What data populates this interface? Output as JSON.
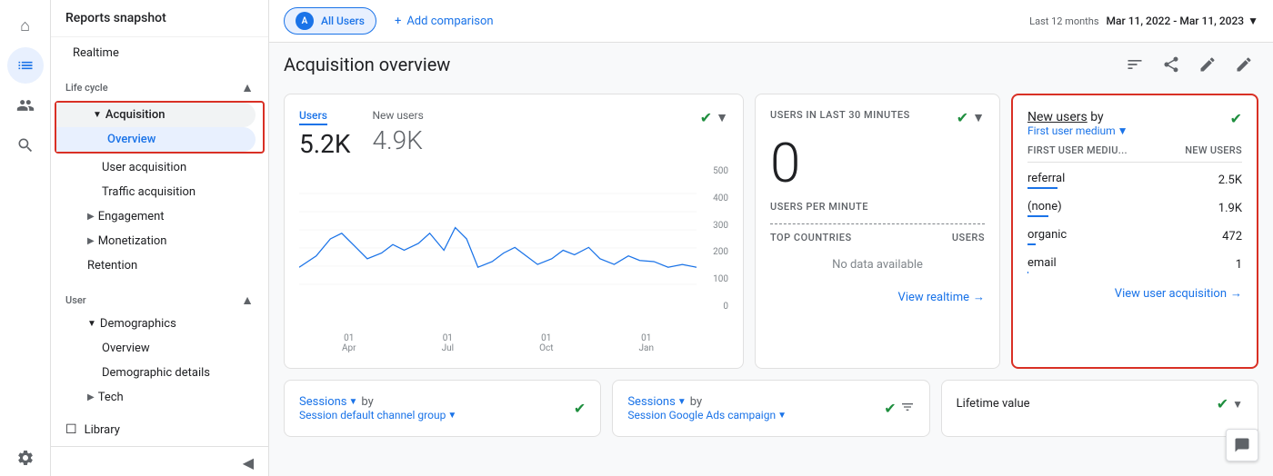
{
  "app": {
    "title": "Reports snapshot"
  },
  "sidebar_left": {
    "icons": [
      {
        "name": "home-icon",
        "symbol": "⌂",
        "active": false
      },
      {
        "name": "analytics-icon",
        "symbol": "📊",
        "active": true
      },
      {
        "name": "people-icon",
        "symbol": "👥",
        "active": false
      },
      {
        "name": "search-icon",
        "symbol": "🔍",
        "active": false
      },
      {
        "name": "settings-icon",
        "symbol": "⚙",
        "active": false
      }
    ]
  },
  "sidebar": {
    "reports_label": "Reports snapshot",
    "realtime_label": "Realtime",
    "lifecycle_label": "Life cycle",
    "acquisition_label": "Acquisition",
    "overview_label": "Overview",
    "user_acquisition_label": "User acquisition",
    "traffic_acquisition_label": "Traffic acquisition",
    "engagement_label": "Engagement",
    "monetization_label": "Monetization",
    "retention_label": "Retention",
    "user_label": "User",
    "demographics_label": "Demographics",
    "dem_overview_label": "Overview",
    "demographic_details_label": "Demographic details",
    "tech_label": "Tech",
    "library_label": "Library"
  },
  "topbar": {
    "filter_label": "All Users",
    "add_comparison_label": "Add comparison",
    "date_range_label": "Last 12 months",
    "date_range_value": "Mar 11, 2022 - Mar 11, 2023"
  },
  "page": {
    "title": "Acquisition overview"
  },
  "main_card": {
    "users_label": "Users",
    "users_value": "5.2K",
    "new_users_label": "New users",
    "new_users_value": "4.9K",
    "chart": {
      "y_labels": [
        "500",
        "400",
        "300",
        "200",
        "100",
        "0"
      ],
      "x_labels": [
        {
          "line1": "01",
          "line2": "Apr"
        },
        {
          "line1": "01",
          "line2": "Jul"
        },
        {
          "line1": "01",
          "line2": "Oct"
        },
        {
          "line1": "01",
          "line2": "Jan"
        }
      ]
    }
  },
  "realtime_card": {
    "header_label": "USERS IN LAST 30 MINUTES",
    "value": "0",
    "sublabel": "USERS PER MINUTE",
    "countries_col1": "TOP COUNTRIES",
    "countries_col2": "USERS",
    "no_data": "No data available",
    "view_link": "View realtime"
  },
  "new_users_card": {
    "header_part1": "New users",
    "header_part2": "by",
    "subheader": "First user medium",
    "col1": "FIRST USER MEDIU...",
    "col2": "NEW USERS",
    "rows": [
      {
        "label": "referral",
        "value": "2.5K",
        "bar_pct": 100
      },
      {
        "label": "(none)",
        "value": "1.9K",
        "bar_pct": 76
      },
      {
        "label": "organic",
        "value": "472",
        "bar_pct": 19
      },
      {
        "label": "email",
        "value": "1",
        "bar_pct": 1
      }
    ],
    "view_link": "View user acquisition"
  },
  "bottom_cards": [
    {
      "metric_label": "Sessions",
      "by_label": "by",
      "dimension_label": "Session default channel group",
      "has_check": true
    },
    {
      "metric_label": "Sessions",
      "by_label": "by",
      "dimension_label": "Session Google Ads campaign",
      "has_check": true,
      "has_filter": true
    },
    {
      "metric_label": "Lifetime value",
      "has_check": true
    }
  ],
  "actions": {
    "customize_icon": "⊞",
    "share_icon": "↗",
    "edit_icon": "✏"
  }
}
